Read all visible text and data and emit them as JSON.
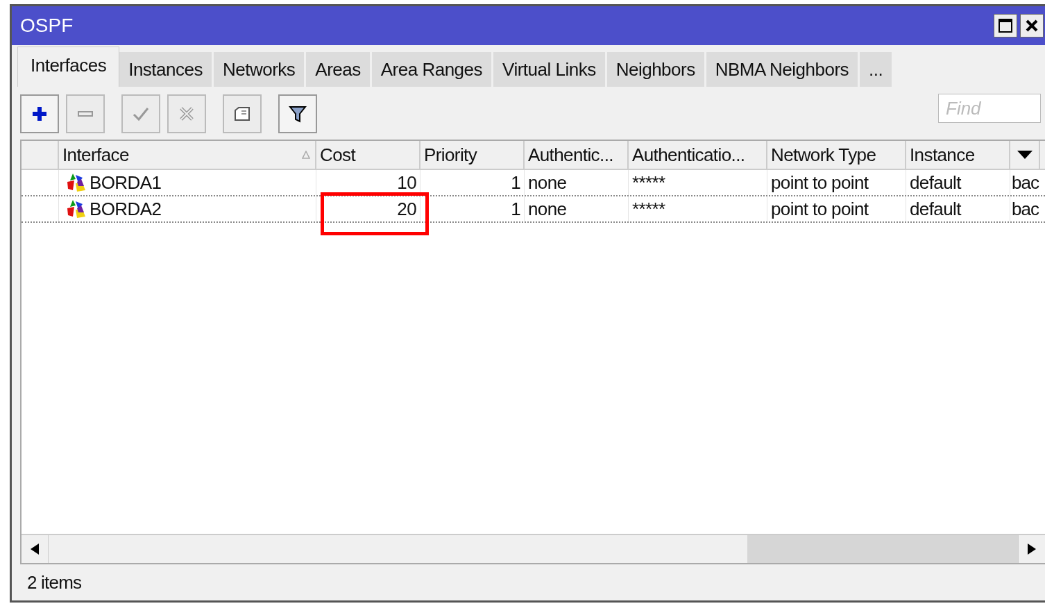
{
  "window": {
    "title": "OSPF"
  },
  "tabs": [
    {
      "label": "Interfaces",
      "selected": true
    },
    {
      "label": "Instances",
      "selected": false
    },
    {
      "label": "Networks",
      "selected": false
    },
    {
      "label": "Areas",
      "selected": false
    },
    {
      "label": "Area Ranges",
      "selected": false
    },
    {
      "label": "Virtual Links",
      "selected": false
    },
    {
      "label": "Neighbors",
      "selected": false
    },
    {
      "label": "NBMA Neighbors",
      "selected": false
    },
    {
      "label": "...",
      "selected": false
    }
  ],
  "toolbar": [
    {
      "kind": "add",
      "disabled": false
    },
    {
      "kind": "remove",
      "disabled": true
    },
    {
      "kind": "enable",
      "disabled": true
    },
    {
      "kind": "disable",
      "disabled": true
    },
    {
      "kind": "comment",
      "disabled": true
    },
    {
      "kind": "filter",
      "disabled": false
    }
  ],
  "search": {
    "placeholder": "Find"
  },
  "table": {
    "columns": [
      {
        "label": "Interface",
        "sorted": true
      },
      {
        "label": "Cost",
        "sorted": false
      },
      {
        "label": "Priority",
        "sorted": false
      },
      {
        "label": "Authentic...",
        "sorted": false
      },
      {
        "label": "Authenticatio...",
        "sorted": false
      },
      {
        "label": "Network Type",
        "sorted": false
      },
      {
        "label": "Instance",
        "sorted": false
      }
    ],
    "rows": [
      {
        "cells": [
          "BORDA1",
          "10",
          "1",
          "none",
          "*****",
          "point to point",
          "default",
          "bac"
        ],
        "cost_highlighted": false
      },
      {
        "cells": [
          "BORDA2",
          "20",
          "1",
          "none",
          "*****",
          "point to point",
          "default",
          "bac"
        ],
        "cost_highlighted": true
      }
    ]
  },
  "status_bar": "2 items"
}
